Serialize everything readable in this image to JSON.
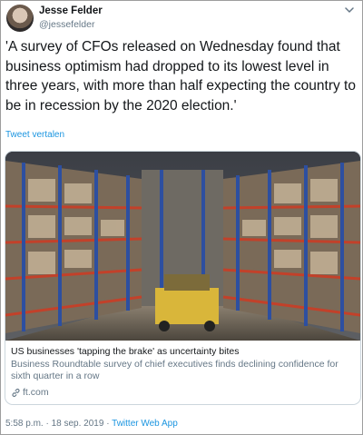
{
  "tweet": {
    "author_name": "Jesse Felder",
    "author_handle": "@jessefelder",
    "text": "'A survey of CFOs released on Wednesday found that business optimism had dropped to its lowest level in three years, with more than half expecting the country to be in recession by the 2020 election.'",
    "translate_label": "Tweet vertalen",
    "time": "5:58 p.m.",
    "separator": " · ",
    "date": "18 sep. 2019",
    "source_app": "Twitter Web App"
  },
  "card": {
    "title": "US businesses 'tapping the brake' as uncertainty bites",
    "description": "Business Roundtable survey of chief executives finds declining confidence for sixth quarter in a row",
    "domain": "ft.com",
    "image_icon": "warehouse-photo"
  },
  "icons": {
    "menu": "chevron-down-icon",
    "link": "link-icon"
  },
  "colors": {
    "link_blue": "#1b95e0",
    "secondary_text": "#657786",
    "border": "#ccd6dd"
  }
}
